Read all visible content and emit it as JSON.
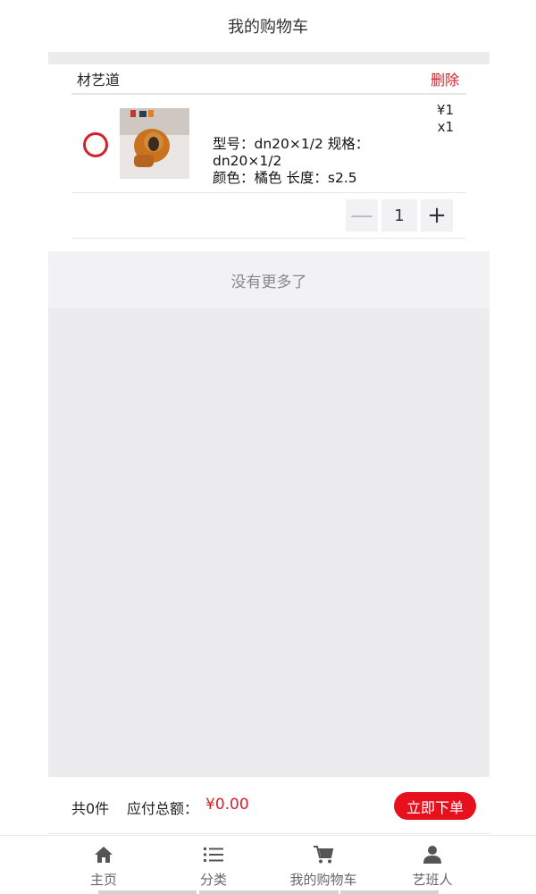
{
  "header": {
    "title": "我的购物车"
  },
  "shop": {
    "name": "材艺道",
    "delete_label": "删除",
    "item": {
      "attr_line1": "型号：dn20×1/2   规格：",
      "attr_line2": "dn20×1/2",
      "attr_line3": "颜色：橘色   长度：s2.5",
      "price": "¥1",
      "quantity_badge": "x1",
      "stepper_value": "1",
      "stepper_minus": "—",
      "stepper_plus": "+",
      "thumbnail_icon": "product-thumbnail"
    }
  },
  "list_end": {
    "text": "没有更多了"
  },
  "summary": {
    "count_label": "共0件",
    "total_label": "应付总额：",
    "total_value": "¥0.00",
    "order_button": "立即下单"
  },
  "tabs": [
    {
      "label": "主页",
      "icon": "home-icon"
    },
    {
      "label": "分类",
      "icon": "list-icon"
    },
    {
      "label": "我的购物车",
      "icon": "cart-icon"
    },
    {
      "label": "艺班人",
      "icon": "person-icon"
    }
  ],
  "colors": {
    "accent": "#d4202b",
    "button": "#e8101c",
    "background": "#ececef"
  }
}
